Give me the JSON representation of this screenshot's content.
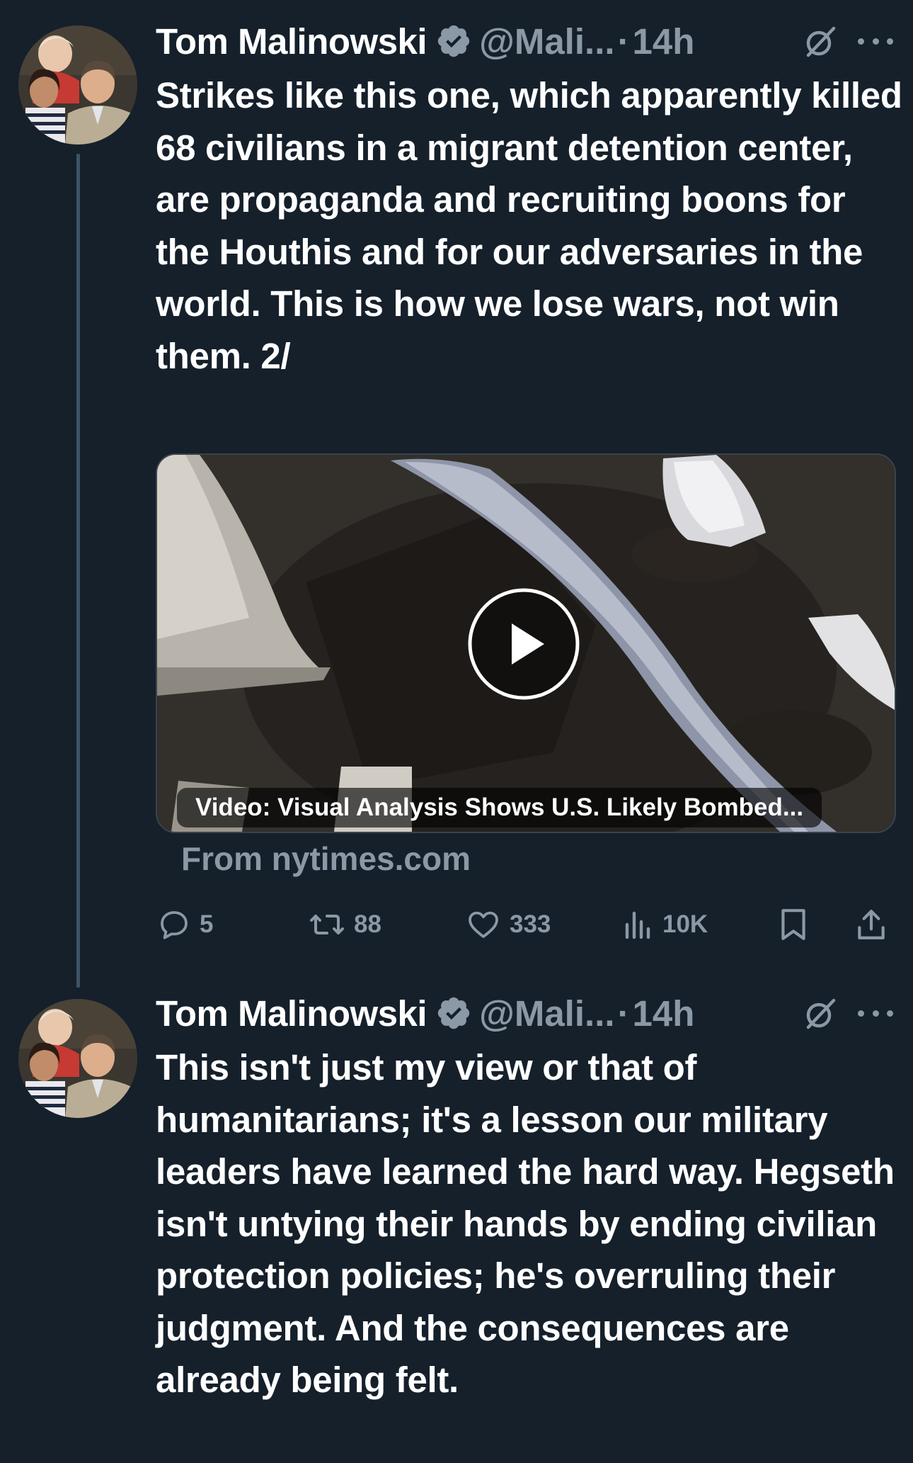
{
  "tweets": [
    {
      "author": {
        "name": "Tom Malinowski",
        "handle": "@Mali...",
        "separator": "·",
        "time": "14h"
      },
      "text": "Strikes like this one, which apparently killed 68 civilians in a migrant detention center, are propaganda and recruiting boons for the Houthis and for our adversaries in the world. This is how we lose wars, not win them. 2/",
      "media": {
        "type": "video",
        "caption": "Video: Visual Analysis Shows U.S. Likely Bombed...",
        "source": "From nytimes.com"
      },
      "stats": {
        "replies": "5",
        "reposts": "88",
        "likes": "333",
        "views": "10K"
      }
    },
    {
      "author": {
        "name": "Tom Malinowski",
        "handle": "@Mali...",
        "separator": "·",
        "time": "14h"
      },
      "text": "This isn't just my view or that of humanitarians; it's a lesson our military leaders have learned the hard way. Hegseth isn't untying their hands by ending civilian protection policies; he's overruling their judgment. And the consequences are already being felt."
    }
  ],
  "colors": {
    "background": "#15202b",
    "text": "#ffffff",
    "secondary_text": "#8b98a5",
    "thread_line": "#3d5466",
    "verified_badge": "#8b98a5"
  },
  "icons": {
    "verified": "verified-badge-icon",
    "grok": "grok-icon",
    "more": "more-options-icon",
    "reply": "reply-icon",
    "repost": "repost-icon",
    "like": "heart-icon",
    "views": "views-icon",
    "bookmark": "bookmark-icon",
    "share": "share-icon",
    "play": "play-icon"
  }
}
